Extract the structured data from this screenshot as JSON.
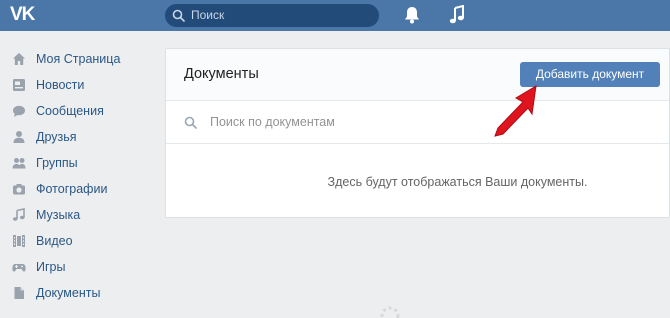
{
  "header": {
    "logo": "VK",
    "search_placeholder": "Поиск",
    "icons": [
      "bell-icon",
      "music-note-icon"
    ]
  },
  "sidebar": {
    "items": [
      {
        "label": "Моя Страница",
        "icon": "home-icon"
      },
      {
        "label": "Новости",
        "icon": "news-icon"
      },
      {
        "label": "Сообщения",
        "icon": "messages-icon"
      },
      {
        "label": "Друзья",
        "icon": "friend-icon"
      },
      {
        "label": "Группы",
        "icon": "groups-icon"
      },
      {
        "label": "Фотографии",
        "icon": "camera-icon"
      },
      {
        "label": "Музыка",
        "icon": "music-icon"
      },
      {
        "label": "Видео",
        "icon": "video-icon"
      },
      {
        "label": "Игры",
        "icon": "gamepad-icon"
      },
      {
        "label": "Документы",
        "icon": "document-icon"
      }
    ]
  },
  "main": {
    "title": "Документы",
    "add_button_label": "Добавить документ",
    "search_placeholder": "Поиск по документам",
    "empty_message": "Здесь будут отображаться Ваши документы."
  },
  "colors": {
    "header_bg": "#4a76a8",
    "page_bg": "#edeef0",
    "link": "#2a5885",
    "button": "#5181b8",
    "annotation_arrow": "#e0141e"
  }
}
